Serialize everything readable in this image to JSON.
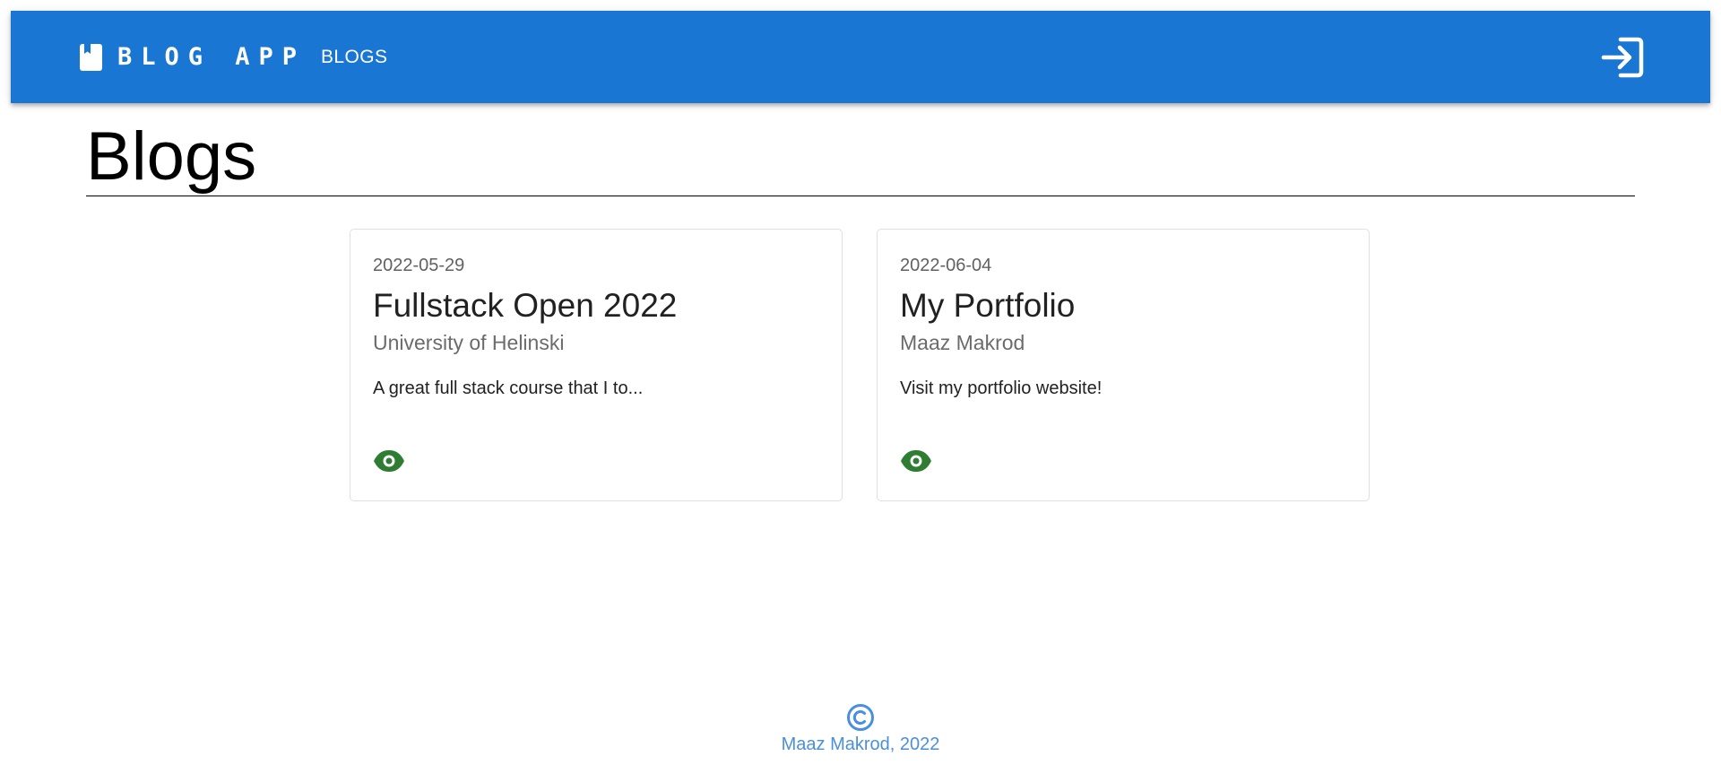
{
  "header": {
    "brand": "BLOG APP",
    "nav_blogs": "BLOGS",
    "accent_color": "#1976d2",
    "brand_icon": "book-icon",
    "login_icon": "login-icon"
  },
  "main": {
    "title": "Blogs"
  },
  "blogs": [
    {
      "date": "2022-05-29",
      "title": "Fullstack Open 2022",
      "author": "University of Helinski",
      "description": "A great full stack course that I to...",
      "action_icon": "eye-icon",
      "action_color": "#2e7d32"
    },
    {
      "date": "2022-06-04",
      "title": "My Portfolio",
      "author": "Maaz Makrod",
      "description": "Visit my portfolio website!",
      "action_icon": "eye-icon",
      "action_color": "#2e7d32"
    }
  ],
  "footer": {
    "icon": "copyright-icon",
    "text": "Maaz Makrod, 2022",
    "color": "#4a90d9"
  }
}
